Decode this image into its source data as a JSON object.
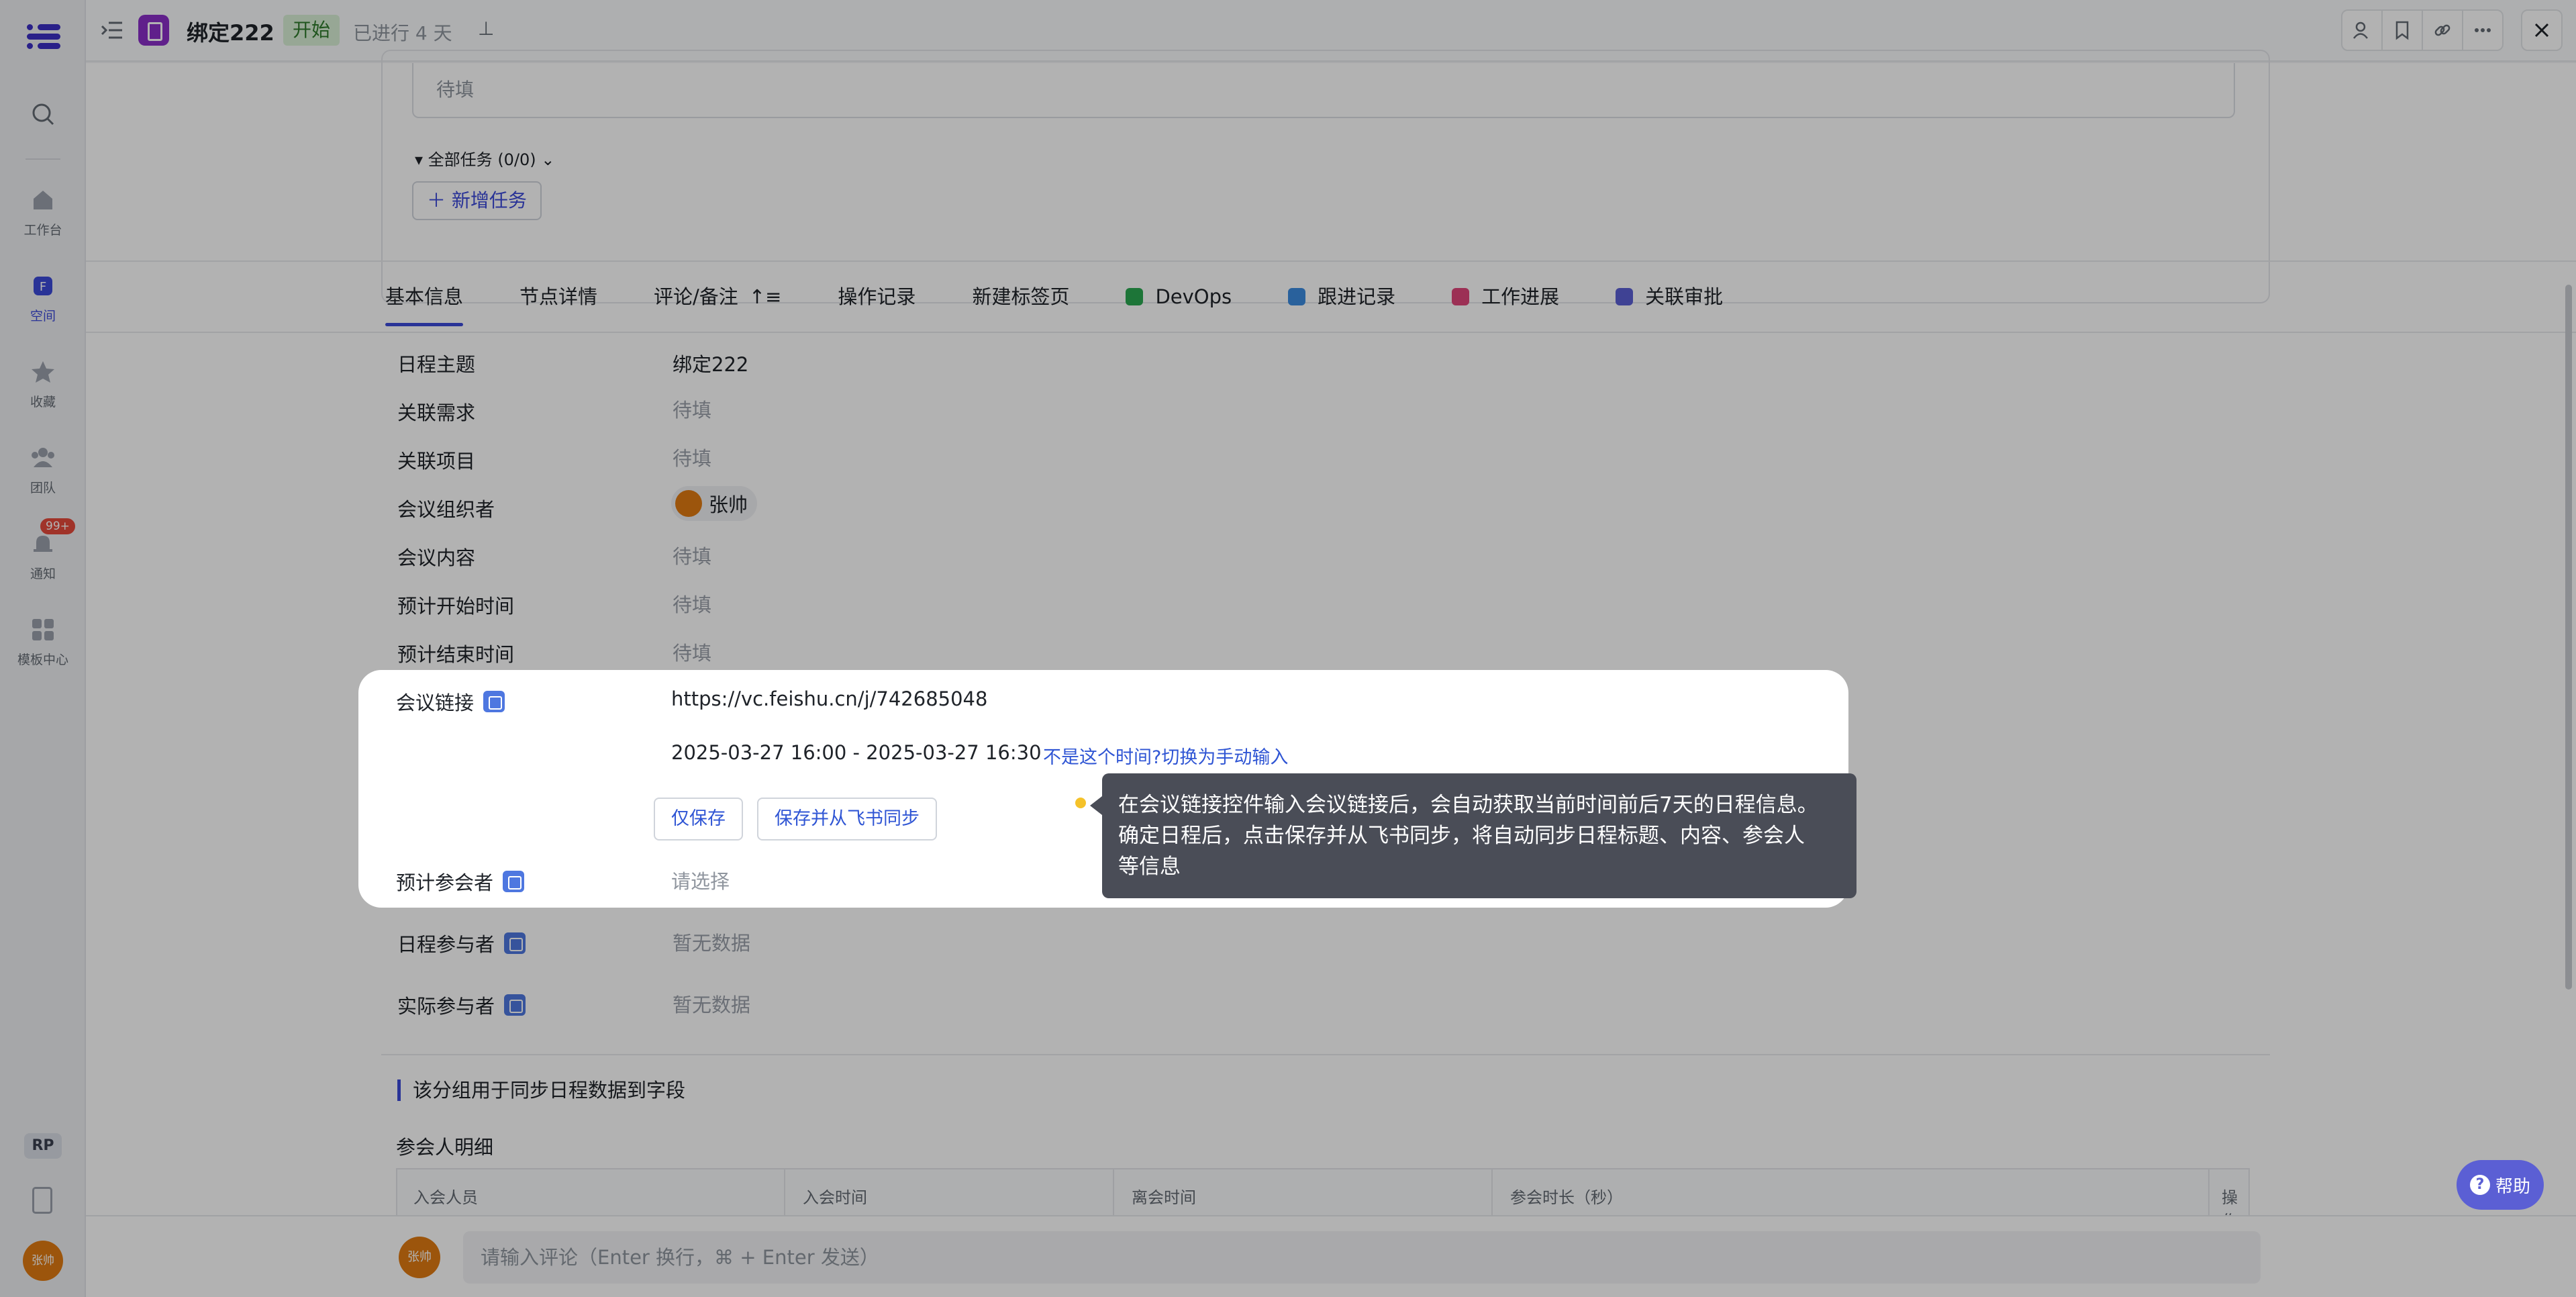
{
  "header": {
    "title": "绑定222",
    "status": "开始",
    "elapsed": "已进行 4 天"
  },
  "sidebar": {
    "items": [
      {
        "label": "工作台",
        "icon": "home-icon"
      },
      {
        "label": "空间",
        "icon": "space-icon"
      },
      {
        "label": "收藏",
        "icon": "star-icon"
      },
      {
        "label": "团队",
        "icon": "team-icon"
      },
      {
        "label": "通知",
        "icon": "bell-icon",
        "badge": "99+"
      },
      {
        "label": "模板中心",
        "icon": "template-icon"
      }
    ],
    "workspace_badge": "RP",
    "user_avatar": "张帅"
  },
  "tasks": {
    "pending_placeholder": "待填",
    "all_tasks": "全部任务 (0/0)",
    "new_task": "新增任务"
  },
  "tabs": [
    "基本信息",
    "节点详情",
    "评论/备注",
    "操作记录",
    "新建标签页",
    "DevOps",
    "跟进记录",
    "工作进展",
    "关联审批"
  ],
  "fields": {
    "subject": {
      "label": "日程主题",
      "value": "绑定222"
    },
    "related_req": {
      "label": "关联需求",
      "value": "待填"
    },
    "related_project": {
      "label": "关联项目",
      "value": "待填"
    },
    "organizer": {
      "label": "会议组织者",
      "value": "张帅"
    },
    "content": {
      "label": "会议内容",
      "value": "待填"
    },
    "start_time": {
      "label": "预计开始时间",
      "value": "待填"
    },
    "end_time": {
      "label": "预计结束时间",
      "value": "待填"
    },
    "schedule_participants": {
      "label": "日程参与者",
      "value": "暂无数据"
    },
    "actual_participants": {
      "label": "实际参与者",
      "value": "暂无数据"
    }
  },
  "spotlight": {
    "link_label": "会议链接",
    "link_value": "https://vc.feishu.cn/j/742685048",
    "time_range": "2025-03-27 16:00 - 2025-03-27 16:30",
    "switch_manual": "不是这个时间?切换为手动输入",
    "save_only": "仅保存",
    "save_sync": "保存并从飞书同步",
    "attendees_label": "预计参会者",
    "attendees_placeholder": "请选择"
  },
  "tooltip": {
    "line1": "在会议链接控件输入会议链接后，会自动获取当前时间前后7天的日程信息。",
    "line2": "确定日程后，点击保存并从飞书同步，将自动同步日程标题、内容、参会人",
    "line3": "等信息"
  },
  "section": {
    "title": "该分组用于同步日程数据到字段",
    "subtitle": "参会人明细",
    "columns": [
      "入会人员",
      "入会时间",
      "离会时间",
      "参会时长（秒）",
      "操作"
    ]
  },
  "comment": {
    "avatar": "张帅",
    "placeholder": "请输入评论（Enter 换行，⌘ + Enter 发送）"
  },
  "help": "帮助",
  "colors": {
    "accent": "#3c49d8",
    "status_bg": "#d9f0d6",
    "tooltip_bg": "#4a4d57"
  }
}
